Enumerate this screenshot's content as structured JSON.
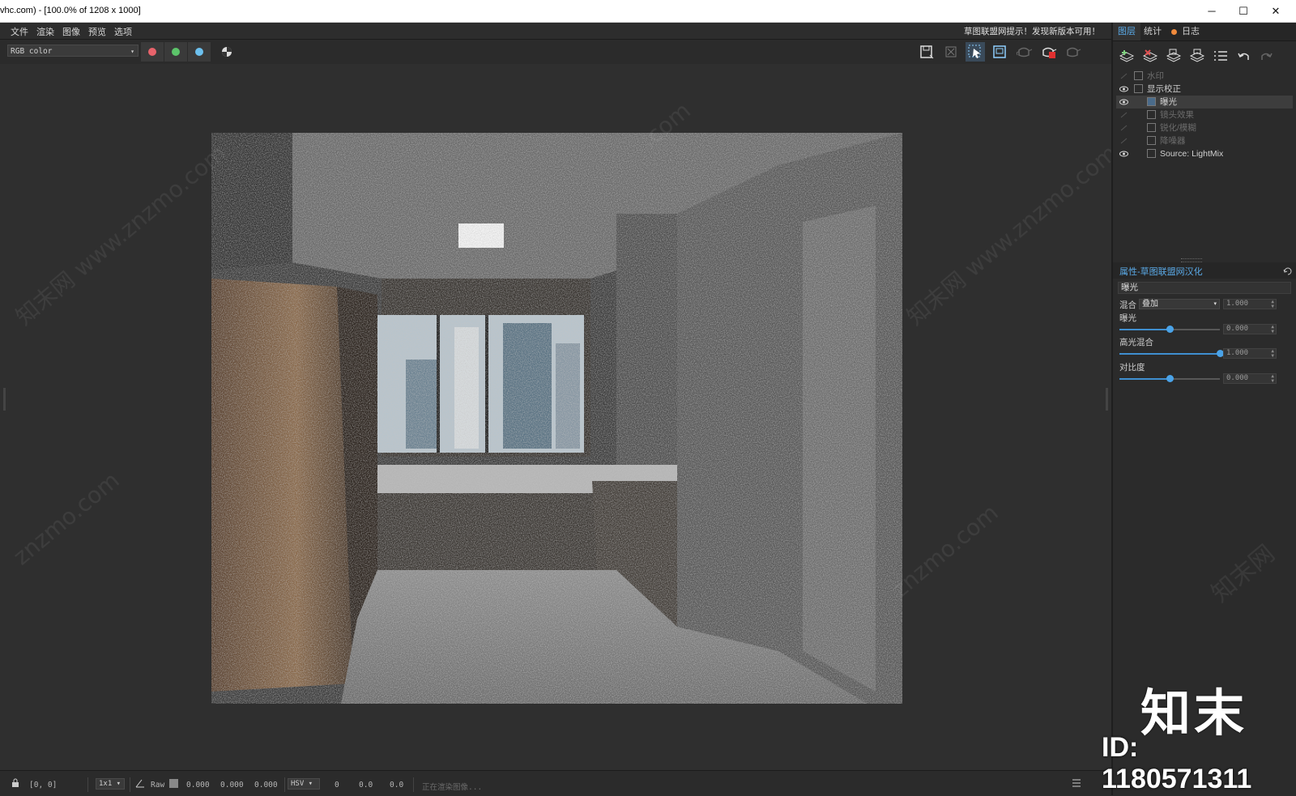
{
  "window": {
    "title": "vhc.com) - [100.0% of 1208 x 1000]",
    "minimize_glyph": "─",
    "maximize_glyph": "☐",
    "close_glyph": "✕"
  },
  "menu": {
    "items": [
      "文件",
      "渲染",
      "图像",
      "预览",
      "选项"
    ],
    "notice": "草图联盟网提示！发现新版本可用！"
  },
  "toolbar": {
    "channel_value": "RGB color",
    "channel_colors": [
      "#e8636b",
      "#5cc46a",
      "#6cc0ee"
    ],
    "icons": [
      "save-icon",
      "clear-icon",
      "region-select-icon",
      "frame-icon",
      "teapot-icon",
      "teapot-stop-icon",
      "teapot-render-icon"
    ]
  },
  "watermarks": [
    "知末网 www.znzmo.com",
    "znzmo.com",
    "知末网 www.znzmo.com",
    "znzmo.com",
    ".com",
    "知末网"
  ],
  "status": {
    "coords": "[0, 0]",
    "zoom": "1x1",
    "raw_label": "Raw",
    "values": [
      "0.000",
      "0.000",
      "0.000"
    ],
    "color_mode": "HSV",
    "hsv_values": [
      "0",
      "0.0",
      "0.0"
    ],
    "progress_text": "正在渲染图像..."
  },
  "panel": {
    "tabs": [
      "图层",
      "统计",
      "日志"
    ],
    "log_dot_color": "#f08a3c",
    "layers": [
      {
        "label": "水印",
        "visible": false,
        "indent": 1
      },
      {
        "label": "显示校正",
        "visible": true,
        "indent": 1
      },
      {
        "label": "曝光",
        "visible": true,
        "indent": 2,
        "selected": true
      },
      {
        "label": "镜头效果",
        "visible": false,
        "indent": 2
      },
      {
        "label": "锐化/模糊",
        "visible": false,
        "indent": 2
      },
      {
        "label": "降噪器",
        "visible": false,
        "indent": 2
      },
      {
        "label": "Source: LightMix",
        "visible": true,
        "indent": 2
      }
    ],
    "props_title": "属性-草图联盟网汉化",
    "props_name": "曝光",
    "blend_label": "混合",
    "blend_value": "叠加",
    "blend_amount": "1.000",
    "exposure_label": "曝光",
    "exposure_value": "0.000",
    "exposure_level": 0.5,
    "highlight_label": "高光混合",
    "highlight_value": "1.000",
    "highlight_level": 1.0,
    "contrast_label": "对比度",
    "contrast_value": "0.000",
    "contrast_level": 0.5
  },
  "overlay": {
    "logo": "知末",
    "id_text": "ID: 1180571311"
  }
}
